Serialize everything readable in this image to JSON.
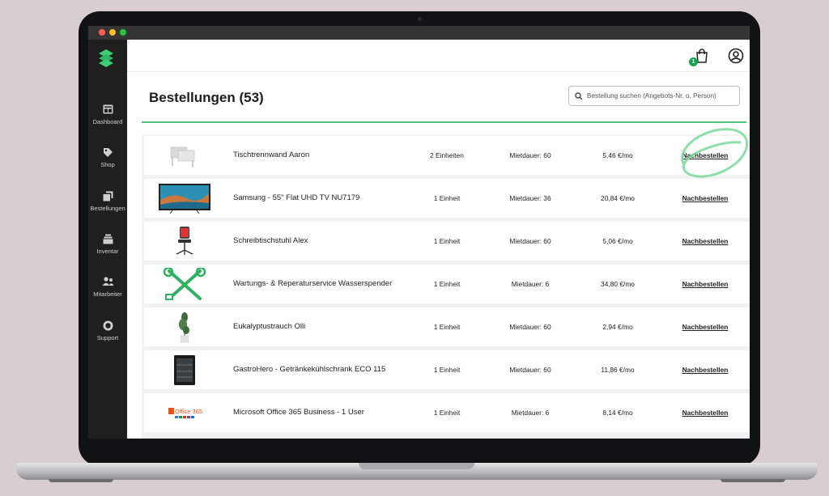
{
  "nav": [
    {
      "label": "Dashboard",
      "icon": "dashboard-icon"
    },
    {
      "label": "Shop",
      "icon": "tag-icon"
    },
    {
      "label": "Bestellungen",
      "icon": "orders-icon"
    },
    {
      "label": "Inventar",
      "icon": "archive-icon"
    },
    {
      "label": "Mitarbeiter",
      "icon": "users-icon"
    },
    {
      "label": "Support",
      "icon": "headset-icon"
    }
  ],
  "header": {
    "cart_count": "1"
  },
  "page": {
    "title": "Bestellungen (53)",
    "search_placeholder": "Bestellung suchen (Angebots-Nr. o. Person)"
  },
  "orders": [
    {
      "name": "Tischtrennwand Aaron",
      "units": "2 Einheiten",
      "duration": "Mietdauer: 60",
      "price": "5,46 €/mo",
      "action": "Nachbestellen",
      "image": "partition-wall"
    },
    {
      "name": "Samsung - 55\" Flat UHD TV NU7179",
      "units": "1 Einheit",
      "duration": "Mietdauer: 36",
      "price": "20,84 €/mo",
      "action": "Nachbestellen",
      "image": "tv"
    },
    {
      "name": "Schreibtischstuhl Alex",
      "units": "1 Einheit",
      "duration": "Mietdauer: 60",
      "price": "5,06 €/mo",
      "action": "Nachbestellen",
      "image": "office-chair"
    },
    {
      "name": "Wartungs- & Reperaturservice Wasserspender",
      "units": "1 Einheit",
      "duration": "Mietdauer: 6",
      "price": "34,80 €/mo",
      "action": "Nachbestellen",
      "image": "tools"
    },
    {
      "name": "Eukalyptustrauch Olli",
      "units": "1 Einheit",
      "duration": "Mietdauer: 60",
      "price": "2,94 €/mo",
      "action": "Nachbestellen",
      "image": "plant"
    },
    {
      "name": "GastroHero - Getränkekühlschrank ECO 115",
      "units": "1 Einheit",
      "duration": "Mietdauer: 60",
      "price": "11,86 €/mo",
      "action": "Nachbestellen",
      "image": "fridge"
    },
    {
      "name": "Microsoft Office 365 Business - 1 User",
      "units": "1 Einheit",
      "duration": "Mietdauer: 6",
      "price": "8,14 €/mo",
      "action": "Nachbestellen",
      "image": "office-logo"
    }
  ],
  "office_logo_text": "Office 365",
  "colors": {
    "accent": "#4fc37a",
    "sidebar": "#1f1f1f",
    "badge": "#16a34a"
  }
}
